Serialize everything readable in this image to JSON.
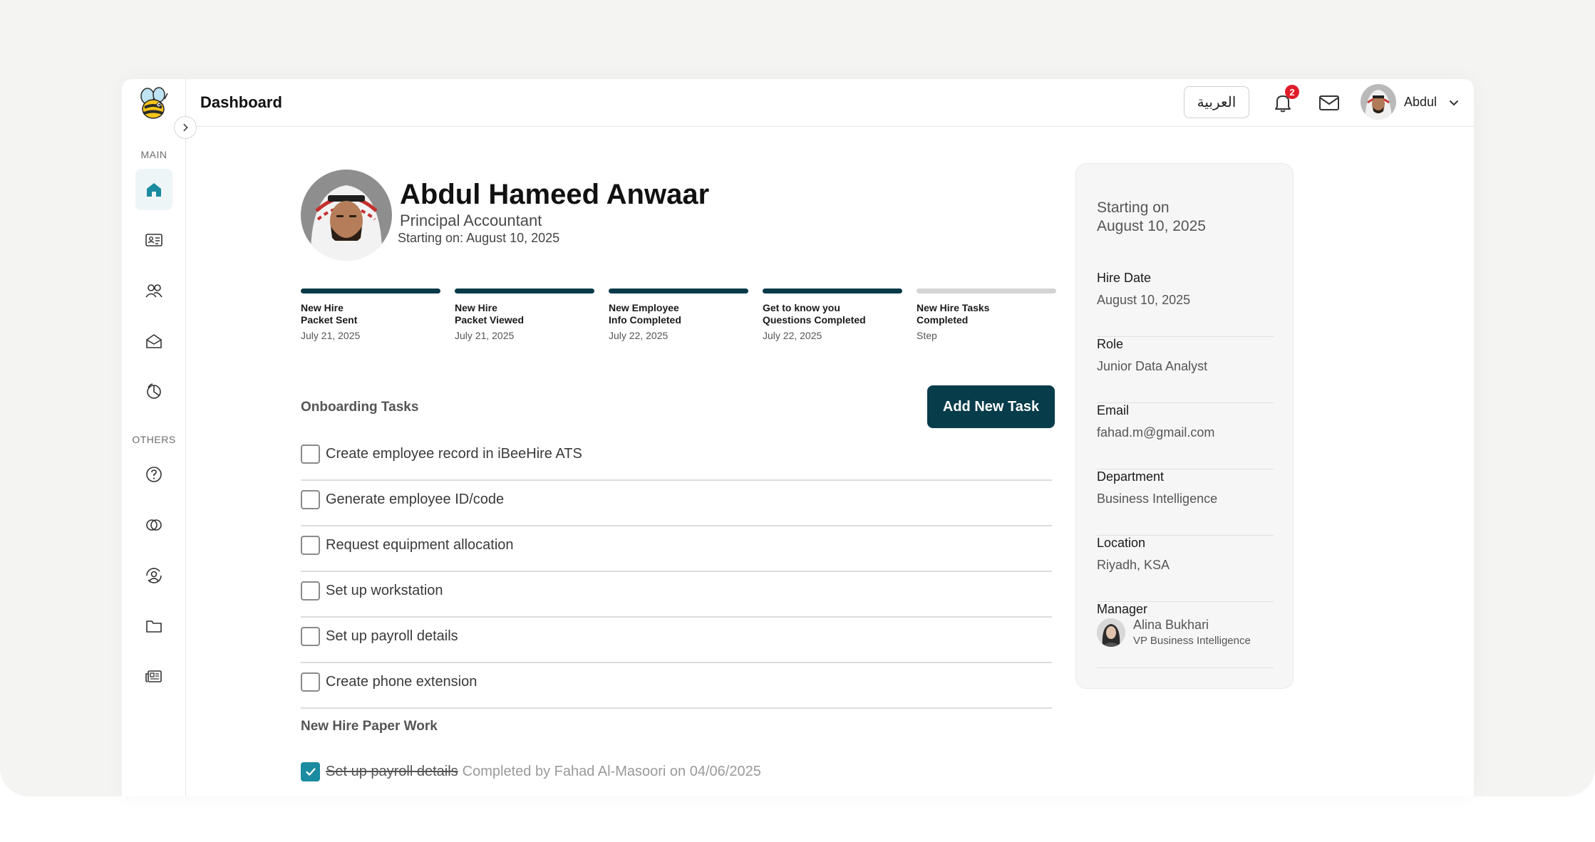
{
  "header": {
    "title": "Dashboard",
    "language_button": "العربية",
    "notification_count": "2",
    "user_name": "Abdul"
  },
  "sidebar": {
    "main_label": "MAIN",
    "others_label": "OTHERS",
    "main_items": [
      "home-icon",
      "id-card-icon",
      "users-icon",
      "mail-open-icon",
      "pie-chart-icon"
    ],
    "others_items": [
      "help-icon",
      "link-icon",
      "user-sync-icon",
      "folder-icon",
      "news-icon"
    ]
  },
  "profile": {
    "name": "Abdul Hameed Anwaar",
    "role": "Principal Accountant",
    "starting": "Starting on: August 10, 2025"
  },
  "steps": [
    {
      "title": "New Hire\nPacket Sent",
      "date": "July 21, 2025",
      "complete": true
    },
    {
      "title": "New Hire\nPacket Viewed",
      "date": "July 21, 2025",
      "complete": true
    },
    {
      "title": "New Employee\nInfo Completed",
      "date": "July 22, 2025",
      "complete": true
    },
    {
      "title": "Get to know you\nQuestions Completed",
      "date": "July 22, 2025",
      "complete": true
    },
    {
      "title": "New Hire Tasks\nCompleted",
      "date": "Step",
      "complete": false
    }
  ],
  "onboarding": {
    "title": "Onboarding Tasks",
    "add_button": "Add New Task",
    "tasks": [
      "Create employee record in iBeeHire ATS",
      "Generate employee ID/code",
      "Request equipment allocation",
      "Set up workstation",
      "Set up payroll details",
      "Create phone extension"
    ]
  },
  "paperwork": {
    "title": "New Hire Paper Work",
    "completed_task": "Set up payroll details",
    "completed_note": "Completed by Fahad Al-Masoori on 04/06/2025"
  },
  "info_card": {
    "starting_line1": "Starting on",
    "starting_line2": "August 10, 2025",
    "hire_date_label": "Hire Date",
    "hire_date": "August 10, 2025",
    "role_label": "Role",
    "role": "Junior Data Analyst",
    "email_label": "Email",
    "email": "fahad.m@gmail.com",
    "department_label": "Department",
    "department": "Business Intelligence",
    "location_label": "Location",
    "location": "Riyadh, KSA",
    "manager_label": "Manager",
    "manager_name": "Alina Bukhari",
    "manager_title": "VP Business Intelligence"
  },
  "colors": {
    "primary": "#073c4b",
    "accent": "#1a8ba0",
    "badge": "#e01e2b"
  }
}
